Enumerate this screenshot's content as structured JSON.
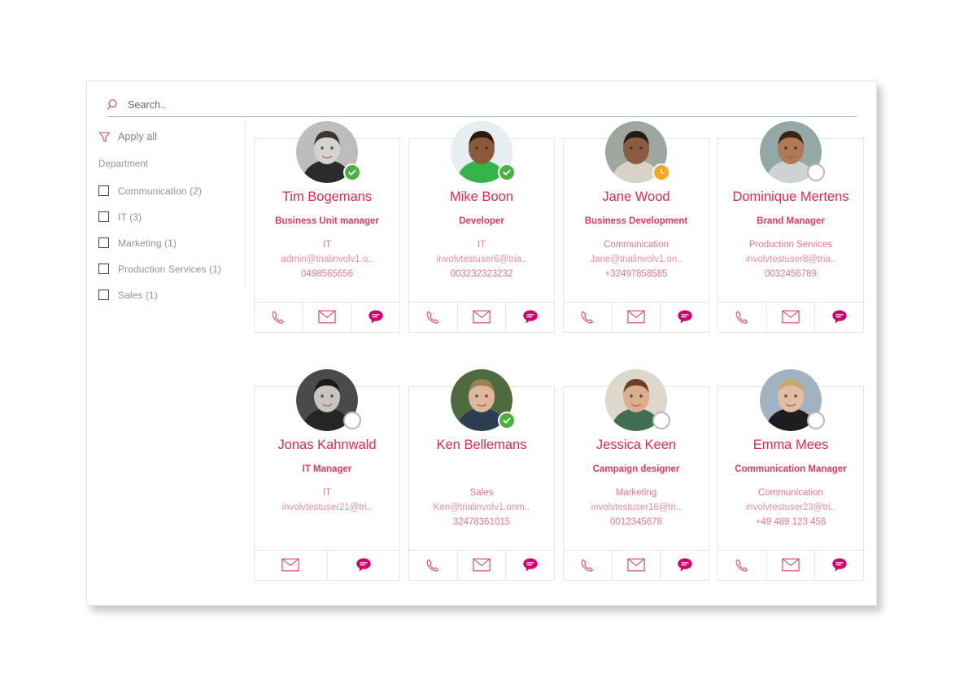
{
  "search": {
    "placeholder": "Search..",
    "value": "",
    "icon": "search-icon"
  },
  "sidebar": {
    "apply_all_label": "Apply all",
    "apply_all_icon": "funnel-icon",
    "facet_title": "Department",
    "facets": [
      {
        "label": "Communication (2)",
        "checked": false
      },
      {
        "label": "IT (3)",
        "checked": false
      },
      {
        "label": "Marketing (1)",
        "checked": false
      },
      {
        "label": "Production Services (1)",
        "checked": false
      },
      {
        "label": "Sales (1)",
        "checked": false
      }
    ]
  },
  "colors": {
    "accent": "#e02851",
    "title": "#e03a5c",
    "muted": "#e8748d",
    "email": "#eb8fa3",
    "available": "#4caf3f",
    "away": "#f5a623",
    "offline": "#b8b8b8",
    "search_underline": "#9eb0c4"
  },
  "actions": {
    "call_label": "Call",
    "email_label": "Email",
    "chat_label": "Chat"
  },
  "cards": [
    {
      "name": "Tim Bogemans",
      "title": "Business Unit manager",
      "department": "IT",
      "email": "admin@trialinvolv1.o..",
      "phone": "0498565656",
      "presence": "available",
      "avatar": "male-suit-bw",
      "actions": [
        "phone-icon",
        "envelope-icon",
        "chat-icon"
      ]
    },
    {
      "name": "Mike Boon",
      "title": "Developer",
      "department": "IT",
      "email": "involvtestuser6@tria..",
      "phone": "003232323232",
      "presence": "available",
      "avatar": "male-green-shirt",
      "actions": [
        "phone-icon",
        "envelope-icon",
        "chat-icon"
      ]
    },
    {
      "name": "Jane Wood",
      "title": "Business Development",
      "department": "Communication",
      "email": "Jane@trialinvolv1.on..",
      "phone": "+32497858585",
      "presence": "away",
      "avatar": "female-curly-dark",
      "actions": [
        "phone-icon",
        "envelope-icon",
        "chat-icon"
      ]
    },
    {
      "name": "Dominique Mertens",
      "title": "Brand Manager",
      "department": "Production Services",
      "email": "involvtestuser8@tria..",
      "phone": "0032456789",
      "presence": "offline",
      "avatar": "female-striped-jacket",
      "actions": [
        "phone-icon",
        "envelope-icon",
        "chat-icon"
      ]
    },
    {
      "name": "Jonas Kahnwald",
      "title": "IT Manager",
      "department": "IT",
      "email": "involvtestuser21@tri..",
      "phone": "",
      "presence": "offline",
      "avatar": "young-male-bw",
      "actions": [
        "envelope-icon",
        "chat-icon"
      ]
    },
    {
      "name": "Ken Bellemans",
      "title": "",
      "department": "Sales",
      "email": "Ken@trialinvolv1.onm..",
      "phone": "32478361015",
      "presence": "available",
      "avatar": "male-polo-outdoor",
      "actions": [
        "phone-icon",
        "envelope-icon",
        "chat-icon"
      ]
    },
    {
      "name": "Jessica Keen",
      "title": "Campaign designer",
      "department": "Marketing",
      "email": "involvtestuser16@tri..",
      "phone": "0012345678",
      "presence": "offline",
      "avatar": "female-curly-smiling",
      "actions": [
        "phone-icon",
        "envelope-icon",
        "chat-icon"
      ]
    },
    {
      "name": "Emma Mees",
      "title": "Communication Manager",
      "department": "Communication",
      "email": "involvtestuser23@tri..",
      "phone": "+49 489 123 456",
      "presence": "offline",
      "avatar": "female-beanie-winter",
      "actions": [
        "phone-icon",
        "envelope-icon",
        "chat-icon"
      ]
    }
  ]
}
